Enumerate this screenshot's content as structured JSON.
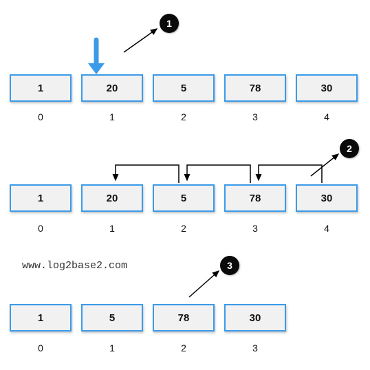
{
  "step1": {
    "marker": "1",
    "values": [
      "1",
      "20",
      "5",
      "78",
      "30"
    ],
    "indices": [
      "0",
      "1",
      "2",
      "3",
      "4"
    ]
  },
  "step2": {
    "marker": "2",
    "values": [
      "1",
      "20",
      "5",
      "78",
      "30"
    ],
    "indices": [
      "0",
      "1",
      "2",
      "3",
      "4"
    ]
  },
  "step3": {
    "marker": "3",
    "values": [
      "1",
      "5",
      "78",
      "30"
    ],
    "indices": [
      "0",
      "1",
      "2",
      "3"
    ]
  },
  "watermark": "www.log2base2.com",
  "colors": {
    "cell_border": "#3c9be8",
    "cell_fill": "#f1f1f1",
    "arrow_blue": "#3c9be8",
    "marker_bg": "#0a0a0a"
  }
}
